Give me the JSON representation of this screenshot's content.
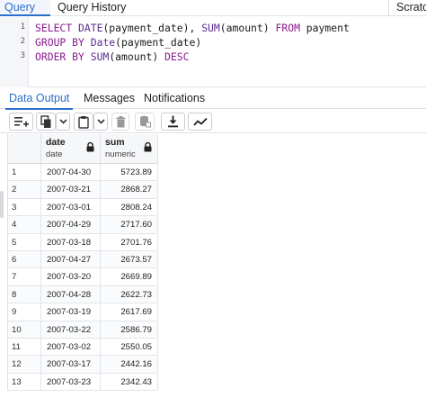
{
  "query_tabs": {
    "query": "Query",
    "history": "Query History",
    "scratch": "Scratch"
  },
  "editor": {
    "line_numbers": [
      "1",
      "2",
      "3"
    ],
    "lines": [
      [
        {
          "t": "SELECT ",
          "k": "kw"
        },
        {
          "t": "DATE",
          "k": "fn"
        },
        {
          "t": "(payment_date), ",
          "k": ""
        },
        {
          "t": "SUM",
          "k": "fn"
        },
        {
          "t": "(amount) ",
          "k": ""
        },
        {
          "t": "FROM",
          "k": "kw"
        },
        {
          "t": " payment",
          "k": ""
        }
      ],
      [
        {
          "t": "GROUP BY ",
          "k": "kw"
        },
        {
          "t": "Date",
          "k": "fn"
        },
        {
          "t": "(payment_date)",
          "k": ""
        }
      ],
      [
        {
          "t": "ORDER BY ",
          "k": "kw"
        },
        {
          "t": "SUM",
          "k": "fn"
        },
        {
          "t": "(amount) ",
          "k": ""
        },
        {
          "t": "DESC",
          "k": "kw"
        }
      ]
    ]
  },
  "output_tabs": {
    "data_output": "Data Output",
    "messages": "Messages",
    "notifications": "Notifications"
  },
  "toolbar": {
    "icons": [
      "add-row-icon",
      "copy-icon",
      "dropdown-icon",
      "paste-icon",
      "dropdown-icon",
      "delete-icon",
      "save-data-icon",
      "download-icon",
      "graph-icon"
    ]
  },
  "grid": {
    "columns": [
      {
        "name": "date",
        "type": "date"
      },
      {
        "name": "sum",
        "type": "numeric"
      }
    ],
    "rows": [
      [
        "1",
        "2007-04-30",
        "5723.89"
      ],
      [
        "2",
        "2007-03-21",
        "2868.27"
      ],
      [
        "3",
        "2007-03-01",
        "2808.24"
      ],
      [
        "4",
        "2007-04-29",
        "2717.60"
      ],
      [
        "5",
        "2007-03-18",
        "2701.76"
      ],
      [
        "6",
        "2007-04-27",
        "2673.57"
      ],
      [
        "7",
        "2007-03-20",
        "2669.89"
      ],
      [
        "8",
        "2007-04-28",
        "2622.73"
      ],
      [
        "9",
        "2007-03-19",
        "2617.69"
      ],
      [
        "10",
        "2007-03-22",
        "2586.79"
      ],
      [
        "11",
        "2007-03-02",
        "2550.05"
      ],
      [
        "12",
        "2007-03-17",
        "2442.16"
      ],
      [
        "13",
        "2007-03-23",
        "2342.43"
      ]
    ]
  },
  "colors": {
    "accent": "#2a6fc9",
    "keyword": "#8a1a8e",
    "function": "#5b2e91"
  }
}
